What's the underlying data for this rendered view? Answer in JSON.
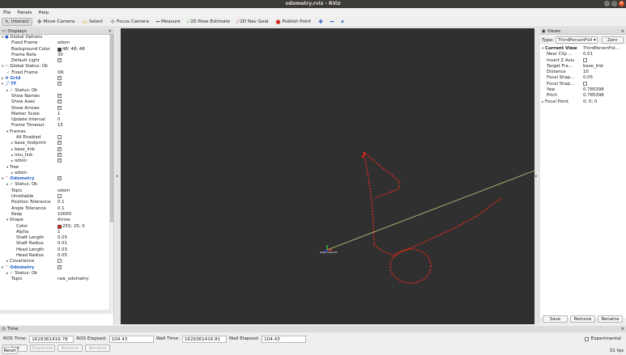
{
  "window": {
    "title": "odometry.rviz - RViz"
  },
  "menu": [
    "File",
    "Panels",
    "Help"
  ],
  "toolbar": [
    {
      "label": "Interact",
      "icon": "interact-icon",
      "glyph": "↖",
      "color": "#444444",
      "active": true
    },
    {
      "label": "Move Camera",
      "icon": "move-camera-icon",
      "glyph": "✥",
      "color": "#666666"
    },
    {
      "label": "Select",
      "icon": "select-icon",
      "glyph": "▭",
      "color": "#c9a400"
    },
    {
      "label": "Focus Camera",
      "icon": "focus-camera-icon",
      "glyph": "✛",
      "color": "#777777"
    },
    {
      "label": "Measure",
      "icon": "measure-icon",
      "glyph": "━",
      "color": "#555555"
    },
    {
      "label": "2D Pose Estimate",
      "icon": "pose-estimate-icon",
      "glyph": "⁄",
      "color": "#3aa63a"
    },
    {
      "label": "2D Nav Goal",
      "icon": "nav-goal-icon",
      "glyph": "⁄",
      "color": "#c0307a"
    },
    {
      "label": "Publish Point",
      "icon": "publish-point-icon",
      "glyph": "●",
      "color": "#d03020"
    },
    {
      "label": "",
      "icon": "add-tool-icon",
      "glyph": "✚",
      "color": "#3060c0"
    },
    {
      "label": "",
      "icon": "remove-tool-icon",
      "glyph": "━",
      "color": "#3060c0"
    },
    {
      "label": "",
      "icon": "tool-properties-icon",
      "glyph": "▾",
      "color": "#3060c0"
    }
  ],
  "displays": {
    "title": "Displays",
    "rows": [
      {
        "i": 0,
        "a": "▾",
        "ic": "●",
        "icolor": "#2b62c7",
        "label": "Global Options"
      },
      {
        "i": 2,
        "label": "Fixed Frame",
        "val": "odom"
      },
      {
        "i": 2,
        "label": "Background Color",
        "val": "48; 48; 48",
        "sw": "#303030"
      },
      {
        "i": 2,
        "label": "Frame Rate",
        "val": "30"
      },
      {
        "i": 2,
        "label": "Default Light",
        "cb": true
      },
      {
        "i": 0,
        "a": "▾",
        "ic": "✓",
        "icolor": "#3a9a3a",
        "label": "Global Status: Ok"
      },
      {
        "i": 1,
        "ic": "✓",
        "icolor": "#3a9a3a",
        "label": "Fixed Frame",
        "val": "OK"
      },
      {
        "i": 0,
        "a": "▸",
        "ic": "❖",
        "icolor": "#2b62c7",
        "label": "Grid",
        "blue": true,
        "cb": true
      },
      {
        "i": 0,
        "a": "▾",
        "ic": "⤴",
        "icolor": "#2b62c7",
        "label": "TF",
        "blue": true,
        "cb": true
      },
      {
        "i": 1,
        "a": "▸",
        "ic": "✓",
        "icolor": "#3a9a3a",
        "label": "Status: Ok"
      },
      {
        "i": 2,
        "label": "Show Names",
        "cb": true
      },
      {
        "i": 2,
        "label": "Show Axes",
        "cb": true
      },
      {
        "i": 2,
        "label": "Show Arrows",
        "cb": true
      },
      {
        "i": 2,
        "label": "Marker Scale",
        "val": "1"
      },
      {
        "i": 2,
        "label": "Update Interval",
        "val": "0"
      },
      {
        "i": 2,
        "label": "Frame Timeout",
        "val": "15"
      },
      {
        "i": 1,
        "a": "▾",
        "label": "Frames"
      },
      {
        "i": 3,
        "label": "All Enabled",
        "cb": false
      },
      {
        "i": 2,
        "a": "▸",
        "label": "base_footprint",
        "cb": true
      },
      {
        "i": 2,
        "a": "▸",
        "label": "base_link",
        "cb": true
      },
      {
        "i": 2,
        "a": "▸",
        "label": "imu_link",
        "cb": true
      },
      {
        "i": 2,
        "a": "▸",
        "label": "odom",
        "cb": true
      },
      {
        "i": 1,
        "a": "▾",
        "label": "Tree"
      },
      {
        "i": 2,
        "a": "▸",
        "label": "odom"
      },
      {
        "i": 0,
        "a": "▾",
        "ic": "⌃",
        "icolor": "#d03020",
        "label": "Odometry",
        "blue": true,
        "cb": true
      },
      {
        "i": 1,
        "a": "▸",
        "ic": "✓",
        "icolor": "#3a9a3a",
        "label": "Status: Ok"
      },
      {
        "i": 2,
        "label": "Topic",
        "val": "odom"
      },
      {
        "i": 2,
        "label": "Unreliable",
        "cb": false
      },
      {
        "i": 2,
        "label": "Position Tolerance",
        "val": "0.1"
      },
      {
        "i": 2,
        "label": "Angle Tolerance",
        "val": "0.1"
      },
      {
        "i": 2,
        "label": "Keep",
        "val": "10000"
      },
      {
        "i": 1,
        "a": "▾",
        "label": "Shape",
        "val": "Arrow"
      },
      {
        "i": 3,
        "label": "Color",
        "val": "255; 25; 0",
        "sw": "#ff1900"
      },
      {
        "i": 3,
        "label": "Alpha",
        "val": "1"
      },
      {
        "i": 3,
        "label": "Shaft Length",
        "val": "0.05"
      },
      {
        "i": 3,
        "label": "Shaft Radius",
        "val": "0.01"
      },
      {
        "i": 3,
        "label": "Head Length",
        "val": "0.03"
      },
      {
        "i": 3,
        "label": "Head Radius",
        "val": "0.05"
      },
      {
        "i": 1,
        "a": "▸",
        "label": "Covariance",
        "cb": false
      },
      {
        "i": 0,
        "a": "▾",
        "ic": "⌃",
        "icolor": "#d03020",
        "label": "Odometry",
        "blue": true,
        "cb": true
      },
      {
        "i": 1,
        "a": "▸",
        "ic": "✓",
        "icolor": "#3a9a3a",
        "label": "Status: Ok"
      },
      {
        "i": 2,
        "label": "Topic",
        "val": "raw_odometry"
      }
    ],
    "buttons": [
      {
        "label": "Add",
        "enabled": true
      },
      {
        "label": "Duplicate",
        "enabled": false
      },
      {
        "label": "Remove",
        "enabled": false
      },
      {
        "label": "Rename",
        "enabled": false
      }
    ]
  },
  "views": {
    "title": "Views",
    "type_label": "Type:",
    "type_value": "ThirdPersonFoll",
    "zero": "Zero",
    "rows": [
      {
        "i": 0,
        "a": "▾",
        "label": "Current View",
        "val": "ThirdPersonFol...",
        "bold": true
      },
      {
        "i": 1,
        "label": "Near Clip ...",
        "val": "0.01"
      },
      {
        "i": 1,
        "label": "Invert Z Axis",
        "cb": false
      },
      {
        "i": 1,
        "label": "Target Fra...",
        "val": "base_link"
      },
      {
        "i": 1,
        "label": "Distance",
        "val": "10"
      },
      {
        "i": 1,
        "label": "Focal Shap...",
        "val": "0.05"
      },
      {
        "i": 1,
        "label": "Focal Shap...",
        "cb": false
      },
      {
        "i": 1,
        "label": "Yaw",
        "val": "0.785398"
      },
      {
        "i": 1,
        "label": "Pitch",
        "val": "0.785398"
      },
      {
        "i": 0,
        "a": "▸",
        "label": "Focal Point",
        "val": "0; 0; 0"
      }
    ],
    "buttons": [
      "Save",
      "Remove",
      "Rename"
    ]
  },
  "time": {
    "title": "Time",
    "ros_time_label": "ROS Time:",
    "ros_time": "1629361416.78",
    "ros_elapsed_label": "ROS Elapsed:",
    "ros_elapsed": "104.43",
    "wall_time_label": "Wall Time:",
    "wall_time": "1629361416.81",
    "wall_elapsed_label": "Wall Elapsed:",
    "wall_elapsed": "104.43",
    "experimental": "Experimental"
  },
  "status": {
    "reset": "Reset",
    "fps": "31 fps"
  },
  "scene": {
    "background": "#303030",
    "path_color": "#ff2a1a",
    "line_color": "#c8c880",
    "robot_label": "base_footprint"
  }
}
